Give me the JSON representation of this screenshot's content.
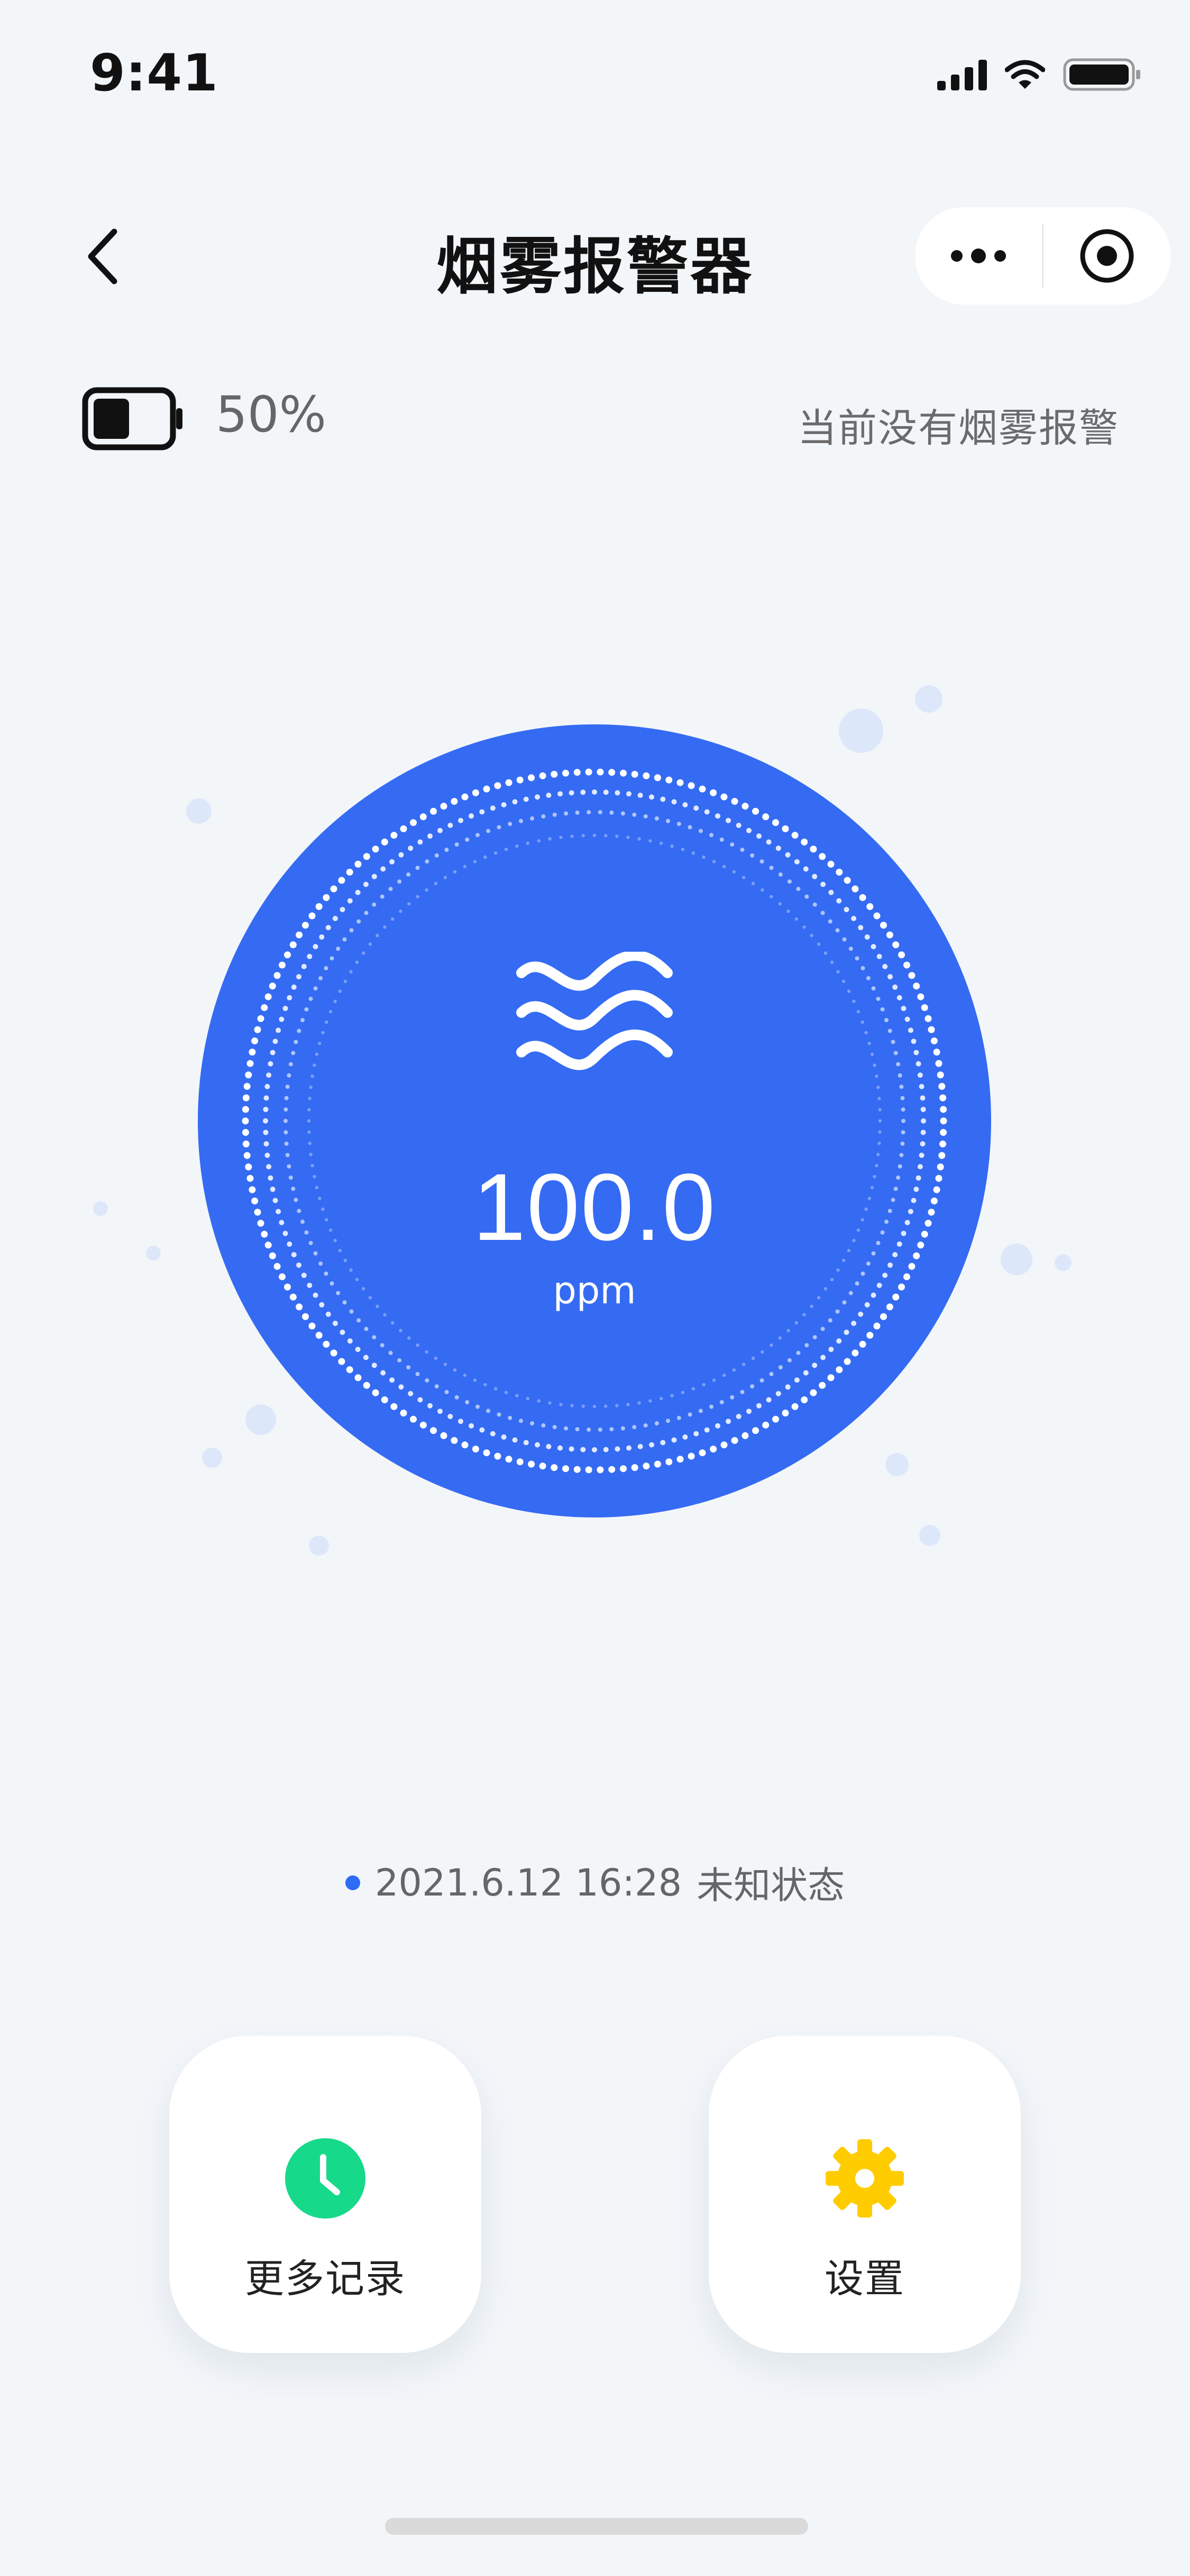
{
  "status_bar": {
    "time": "9:41"
  },
  "nav": {
    "title": "烟雾报警器"
  },
  "device": {
    "battery_percent": "50%",
    "battery_level": 0.5,
    "alarm_status": "当前没有烟雾报警"
  },
  "gauge": {
    "value": "100.0",
    "unit": "ppm",
    "icon": "waves-icon",
    "color": "#356bf3"
  },
  "last_update": {
    "timestamp": "2021.6.12 16:28",
    "state": "未知状态"
  },
  "actions": [
    {
      "label": "更多记录",
      "icon": "clock-icon",
      "color": "#17d98a"
    },
    {
      "label": "设置",
      "icon": "gear-icon",
      "color": "#ffcc00"
    }
  ]
}
